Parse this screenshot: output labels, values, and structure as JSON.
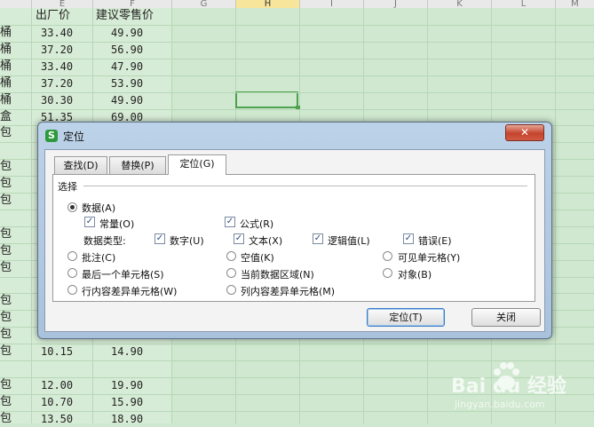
{
  "sheet": {
    "columns": [
      "E",
      "F",
      "G",
      "H",
      "I",
      "J",
      "K",
      "L",
      "M"
    ],
    "selected_column": "H",
    "header_cells": [
      "出厂价",
      "建议零售价"
    ],
    "row_labels": [
      "桶",
      "桶",
      "桶",
      "桶",
      "桶",
      "盒",
      "包",
      "",
      "包",
      "包",
      "包",
      "",
      "包",
      "包",
      "包",
      "",
      "包",
      "包",
      "包",
      "包",
      "",
      "包",
      "包",
      "包"
    ],
    "prices": [
      [
        "33.40",
        "49.90"
      ],
      [
        "37.20",
        "56.90"
      ],
      [
        "33.40",
        "47.90"
      ],
      [
        "37.20",
        "53.90"
      ],
      [
        "30.30",
        "49.90"
      ],
      [
        "51.35",
        "69.00"
      ],
      [
        "",
        ""
      ],
      [
        "",
        ""
      ],
      [
        "",
        ""
      ],
      [
        "",
        ""
      ],
      [
        "",
        ""
      ],
      [
        "",
        ""
      ],
      [
        "",
        ""
      ],
      [
        "",
        ""
      ],
      [
        "",
        ""
      ],
      [
        "",
        ""
      ],
      [
        "",
        ""
      ],
      [
        "",
        ""
      ],
      [
        "",
        ""
      ],
      [
        "10.15",
        "14.90"
      ],
      [
        "",
        ""
      ],
      [
        "12.00",
        "19.90"
      ],
      [
        "10.70",
        "15.90"
      ],
      [
        "13.50",
        "18.90"
      ]
    ]
  },
  "dialog": {
    "icon": "S",
    "title": "定位",
    "close": "✕",
    "tabs": [
      "查找(D)",
      "替换(P)",
      "定位(G)"
    ],
    "active_tab": 2,
    "group_label": "选择",
    "opt_data": "数据(A)",
    "chk_constant": "常量(O)",
    "chk_formula": "公式(R)",
    "data_type_label": "数据类型:",
    "chk_number": "数字(U)",
    "chk_text": "文本(X)",
    "chk_logical": "逻辑值(L)",
    "chk_error": "错误(E)",
    "opt_comment": "批注(C)",
    "opt_blank": "空值(K)",
    "opt_visible": "可见单元格(Y)",
    "opt_last_cell": "最后一个单元格(S)",
    "opt_current_region": "当前数据区域(N)",
    "opt_object": "对象(B)",
    "opt_row_diff": "行内容差异单元格(W)",
    "opt_col_diff": "列内容差异单元格(M)",
    "btn_locate": "定位(T)",
    "btn_close": "关闭"
  },
  "watermark": {
    "brand": "Bai du 经验",
    "url": "jingyan.baidu.com"
  }
}
